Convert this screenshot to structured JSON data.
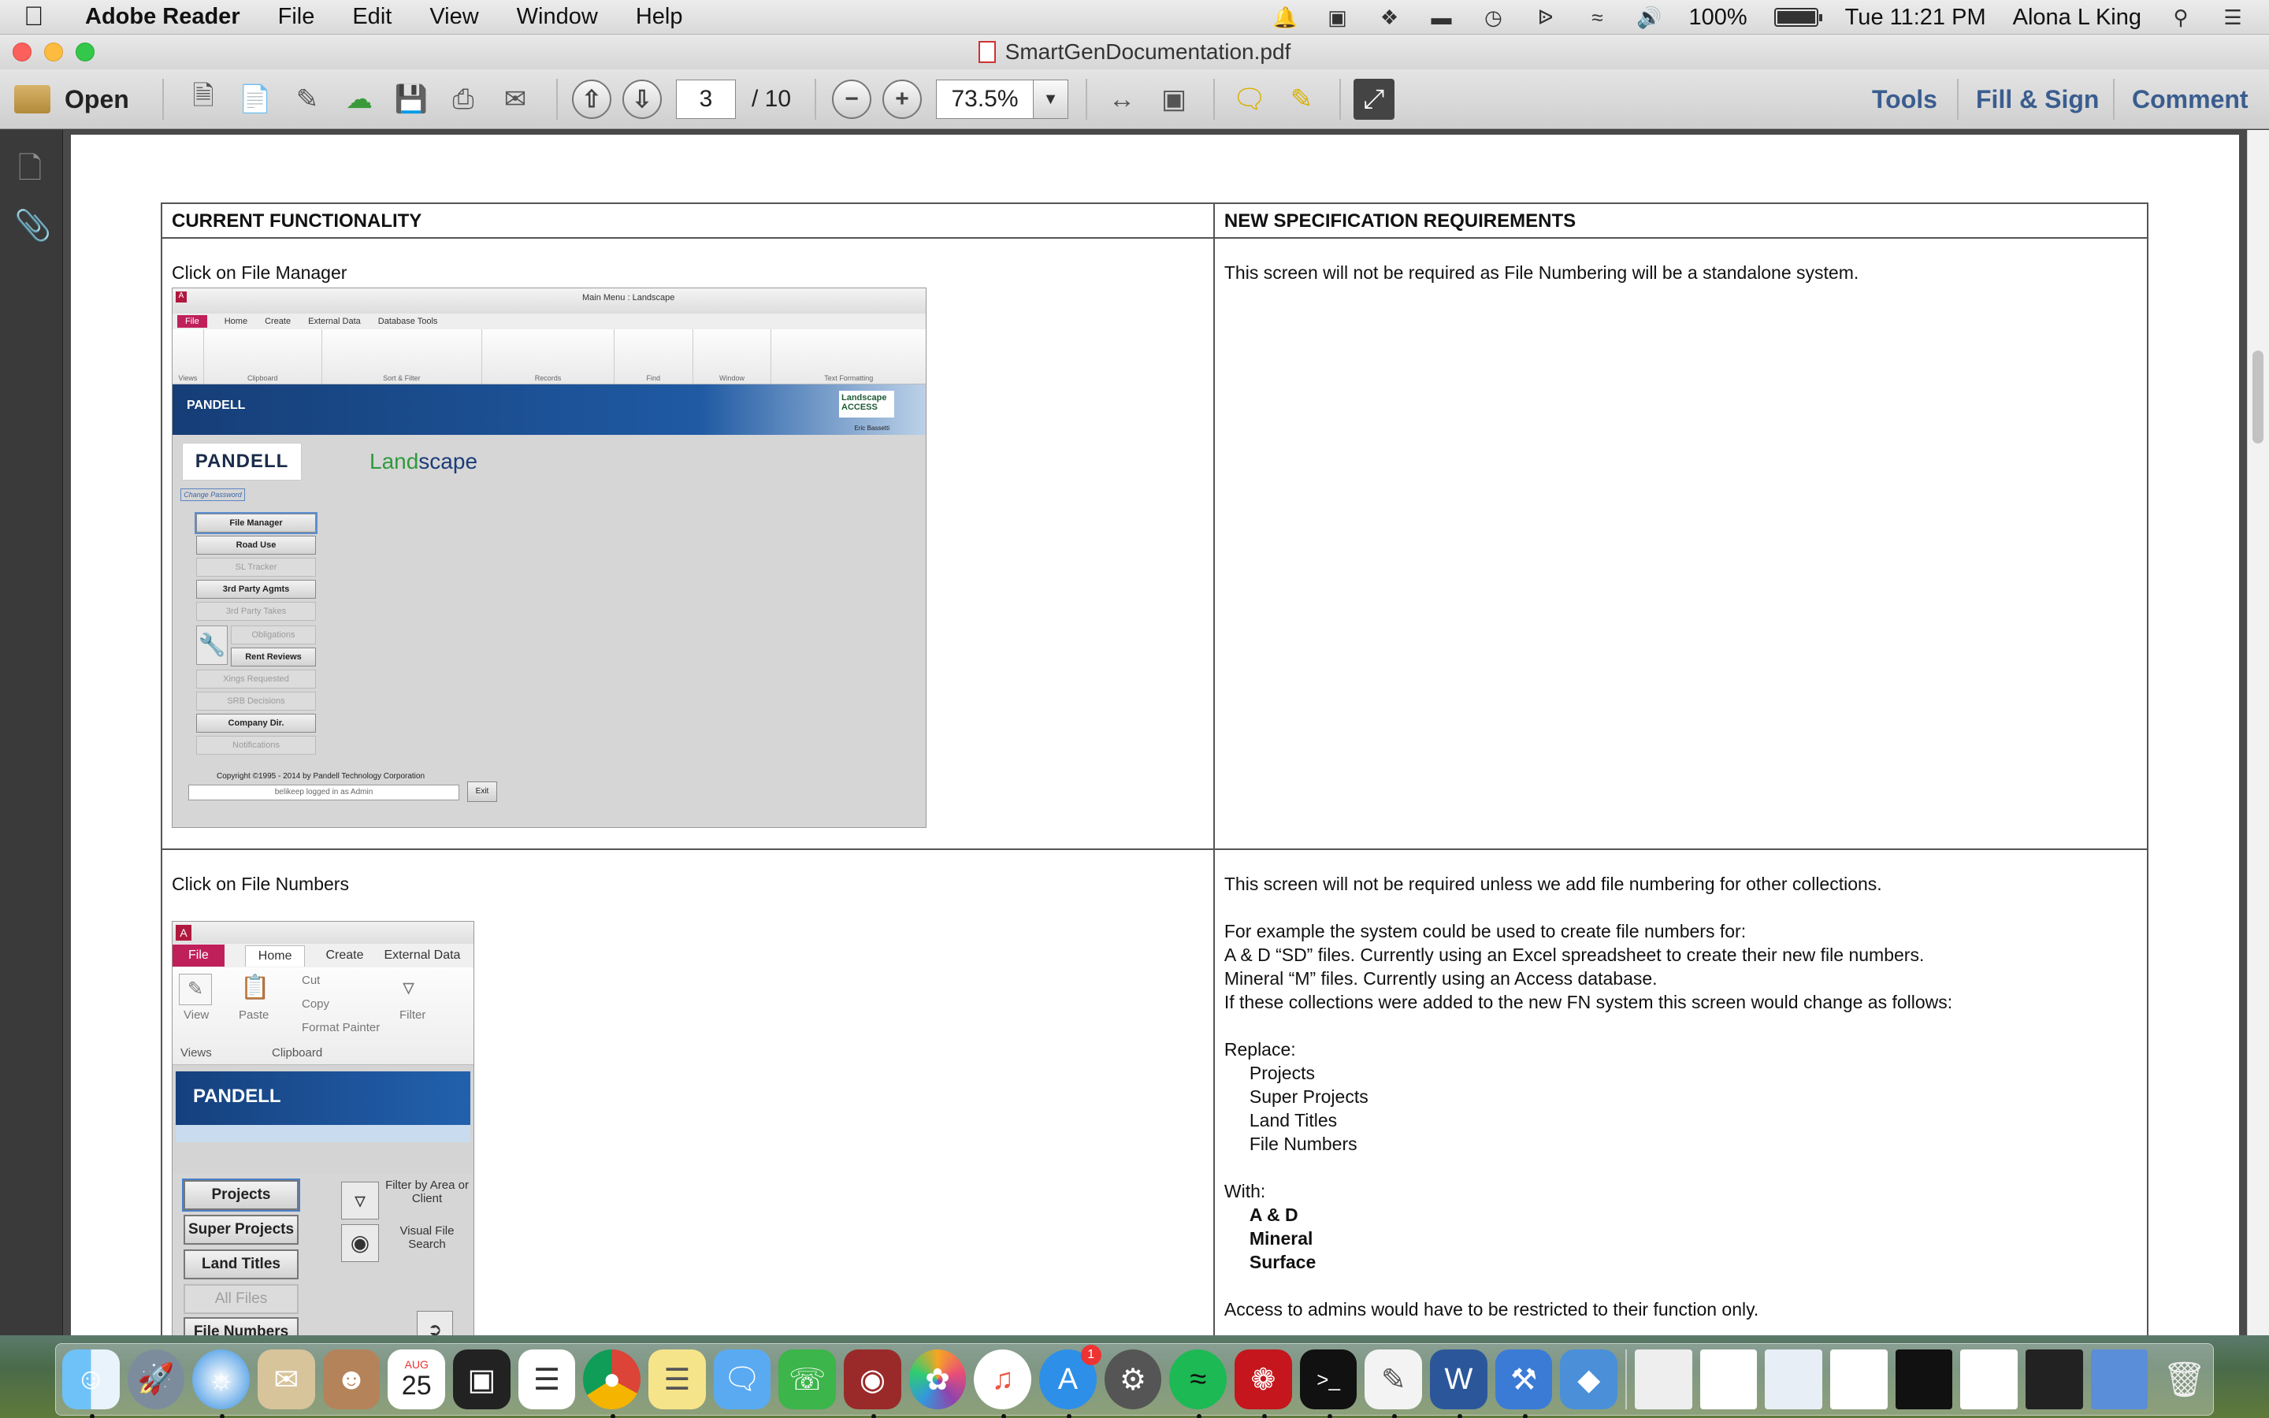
{
  "menubar": {
    "app_name": "Adobe Reader",
    "items": [
      "File",
      "Edit",
      "View",
      "Window",
      "Help"
    ],
    "battery": "100%",
    "clock": "Tue 11:21 PM",
    "user": "Alona L King"
  },
  "window": {
    "title": "SmartGenDocumentation.pdf"
  },
  "toolbar": {
    "open_label": "Open",
    "page_current": "3",
    "page_total": "/ 10",
    "zoom": "73.5%",
    "tools_label": "Tools",
    "fill_sign_label": "Fill & Sign",
    "comment_label": "Comment"
  },
  "document": {
    "headers": [
      "CURRENT FUNCTIONALITY",
      "NEW SPECIFICATION REQUIREMENTS"
    ],
    "row1": {
      "left_caption": "Click on File Manager",
      "right_text": "This screen will not be required as File Numbering will be a standalone system."
    },
    "row2": {
      "left_caption": "Click on File Numbers",
      "right_intro": "This screen will not be required unless we add file numbering for other collections.",
      "right_example_lines": [
        "For example the system could be used to create file numbers for:",
        "A & D “SD” files.  Currently using an Excel spreadsheet to create their new file numbers.",
        "Mineral “M” files.  Currently using an Access database.",
        "If these collections were added to the new FN system this screen would change as follows:"
      ],
      "replace_label": "Replace:",
      "replace_items": [
        "Projects",
        "Super Projects",
        "Land Titles",
        "File Numbers"
      ],
      "with_label": "With:",
      "with_items": [
        "A & D",
        "Mineral",
        "Surface"
      ],
      "access_note": "Access to admins would have to be restricted to their function only."
    }
  },
  "screenshot1": {
    "window_title": "Main Menu : Landscape",
    "tabs": [
      "File",
      "Home",
      "Create",
      "External Data",
      "Database Tools"
    ],
    "groups": [
      "Views",
      "Clipboard",
      "Sort & Filter",
      "Records",
      "Find",
      "Window",
      "Text Formatting"
    ],
    "banner": "PANDELL",
    "banner_badge": "Landscape ACCESS",
    "user_line": "Eric Bassetti",
    "logo": "PANDELL",
    "land": "Land",
    "scape": "scape",
    "change_password": "Change Password",
    "buttons": [
      {
        "label": "File Manager",
        "state": "selected"
      },
      {
        "label": "Road Use",
        "state": "enabled"
      },
      {
        "label": "SL Tracker",
        "state": "disabled"
      },
      {
        "label": "3rd Party Agmts",
        "state": "enabled"
      },
      {
        "label": "3rd Party Takes",
        "state": "disabled"
      },
      {
        "label": "Obligations",
        "state": "disabled"
      },
      {
        "label": "Rent Reviews",
        "state": "enabled"
      },
      {
        "label": "Xings Requested",
        "state": "disabled"
      },
      {
        "label": "SRB Decisions",
        "state": "disabled"
      },
      {
        "label": "Company Dir.",
        "state": "enabled"
      },
      {
        "label": "Notifications",
        "state": "disabled"
      }
    ],
    "copyright": "Copyright ©1995 - 2014 by Pandell Technology Corporation",
    "login": "belikeep logged in as Admin",
    "exit": "Exit"
  },
  "screenshot2": {
    "tabs": [
      "File",
      "Home",
      "Create",
      "External Data"
    ],
    "ribbon_items": [
      "View",
      "Paste",
      "Cut",
      "Copy",
      "Format Painter",
      "Filter"
    ],
    "groups": [
      "Views",
      "Clipboard"
    ],
    "banner": "PANDELL",
    "buttons": [
      {
        "label": "Projects",
        "state": "selected"
      },
      {
        "label": "Super Projects",
        "state": "enabled"
      },
      {
        "label": "Land Titles",
        "state": "enabled"
      },
      {
        "label": "All Files",
        "state": "disabled"
      },
      {
        "label": "File Numbers",
        "state": "enabled"
      }
    ],
    "filter_label": "Filter by Area or Client",
    "search_label": "Visual File Search"
  },
  "dock": {
    "apps": [
      "Finder",
      "Launchpad",
      "Safari",
      "Mail",
      "Contacts",
      "Calendar",
      "Photo Booth",
      "Reminders",
      "Chrome",
      "Notes",
      "Messages",
      "FaceTime",
      "Photo Booth 2",
      "Photos",
      "iTunes",
      "App Store",
      "System Preferences",
      "Spotify",
      "Adobe Reader",
      "Terminal",
      "TextEdit",
      "Word",
      "Xcode",
      "Instruments"
    ],
    "calendar_month": "AUG",
    "calendar_day": "25",
    "appstore_badge": "1"
  }
}
